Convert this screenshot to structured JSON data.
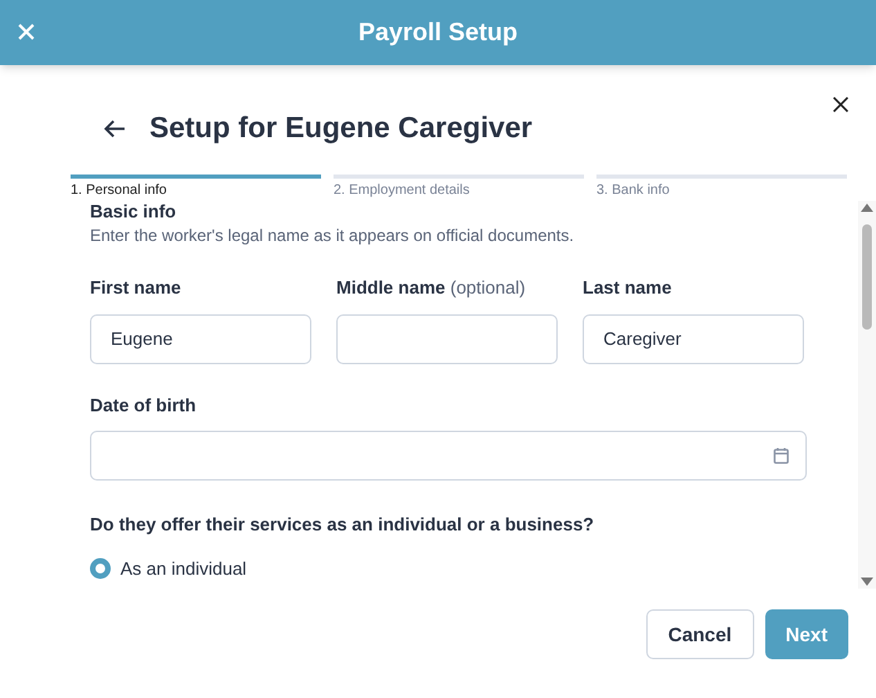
{
  "header": {
    "title": "Payroll Setup"
  },
  "dialog": {
    "title": "Setup for Eugene Caregiver"
  },
  "steps": [
    {
      "label": "1. Personal info",
      "selected": true
    },
    {
      "label": "2. Employment details",
      "selected": false
    },
    {
      "label": "3. Bank info",
      "selected": false
    }
  ],
  "section": {
    "title": "Basic info",
    "description": "Enter the worker's legal name as it appears on official documents."
  },
  "name_fields": [
    {
      "label": "First name",
      "value": "Eugene"
    },
    {
      "label": "Middle name",
      "hint": "(optional)"
    },
    {
      "label": "Last name",
      "value": "Caregiver"
    }
  ],
  "date_of_birth": {
    "label": "Date of birth"
  },
  "question": {
    "label": "Do they offer their services as an individual or a business?",
    "options": [
      {
        "label": "As an individual",
        "selected": true
      }
    ]
  },
  "buttons": [
    {
      "label": "Cancel",
      "kind": "secondary"
    },
    {
      "label": "Next",
      "kind": "primary"
    }
  ]
}
